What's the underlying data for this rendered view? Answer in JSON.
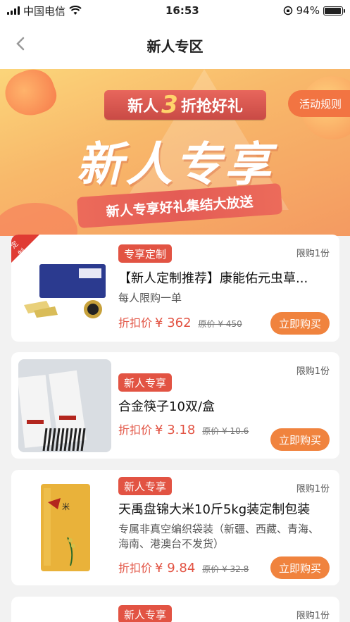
{
  "status": {
    "carrier": "中国电信",
    "time": "16:53",
    "battery": "94%",
    "battery_level": 0.94
  },
  "nav": {
    "title": "新人专区"
  },
  "banner": {
    "pill_prefix": "新人",
    "pill_num": "3",
    "pill_suffix": "折抢好礼",
    "rules": "活动规则",
    "title": "新人专享",
    "subtitle": "新人专享好礼集结大放送"
  },
  "products": [
    {
      "corner": "定制",
      "tag": "专享定制",
      "limit": "限购1份",
      "name": "【新人定制推荐】康能佑元虫草...",
      "desc": "每人限购一单",
      "price_label": "折扣价",
      "price": "¥ 362",
      "orig": "原价 ¥ 450",
      "buy": "立即购买"
    },
    {
      "tag": "新人专享",
      "limit": "限购1份",
      "name": "合金筷子10双/盒",
      "price_label": "折扣价",
      "price": "¥ 3.18",
      "orig": "原价 ¥ 10.6",
      "buy": "立即购买"
    },
    {
      "tag": "新人专享",
      "limit": "限购1份",
      "name": "天禹盘锦大米10斤5kg装定制包装",
      "desc": "专属非真空编织袋装（新疆、西藏、青海、海南、港澳台不发货）",
      "price_label": "折扣价",
      "price": "¥ 9.84",
      "orig": "原价 ¥ 32.8",
      "buy": "立即购买"
    },
    {
      "tag": "新人专享",
      "limit": "限购1份"
    }
  ]
}
